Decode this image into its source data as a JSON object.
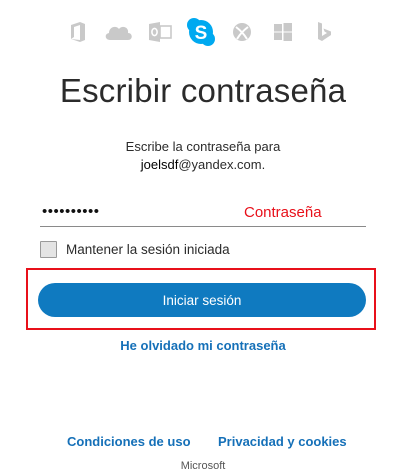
{
  "app_bar": {
    "icons": [
      "office-icon",
      "onedrive-icon",
      "outlook-icon",
      "skype-icon",
      "xbox-icon",
      "windows-icon",
      "bing-icon"
    ],
    "active": "skype-icon",
    "active_color": "#00a9f0",
    "inactive_color": "#c9c9c9"
  },
  "page": {
    "title": "Escribir contraseña",
    "instruction": "Escribe la contraseña para",
    "account_user": "joelsdf",
    "account_domain": "@yandex.com."
  },
  "password": {
    "value": "••••••••••",
    "annotation": "Contraseña"
  },
  "keep_signed_in": {
    "label": "Mantener la sesión iniciada",
    "checked": false
  },
  "signin": {
    "label": "Iniciar sesión",
    "color": "#0f7ac0"
  },
  "forgot": {
    "label": "He olvidado mi contraseña"
  },
  "footer": {
    "terms": "Condiciones de uso",
    "privacy": "Privacidad y cookies",
    "brand": "Microsoft"
  },
  "colors": {
    "link": "#1570b8",
    "highlight": "#e8101a"
  }
}
